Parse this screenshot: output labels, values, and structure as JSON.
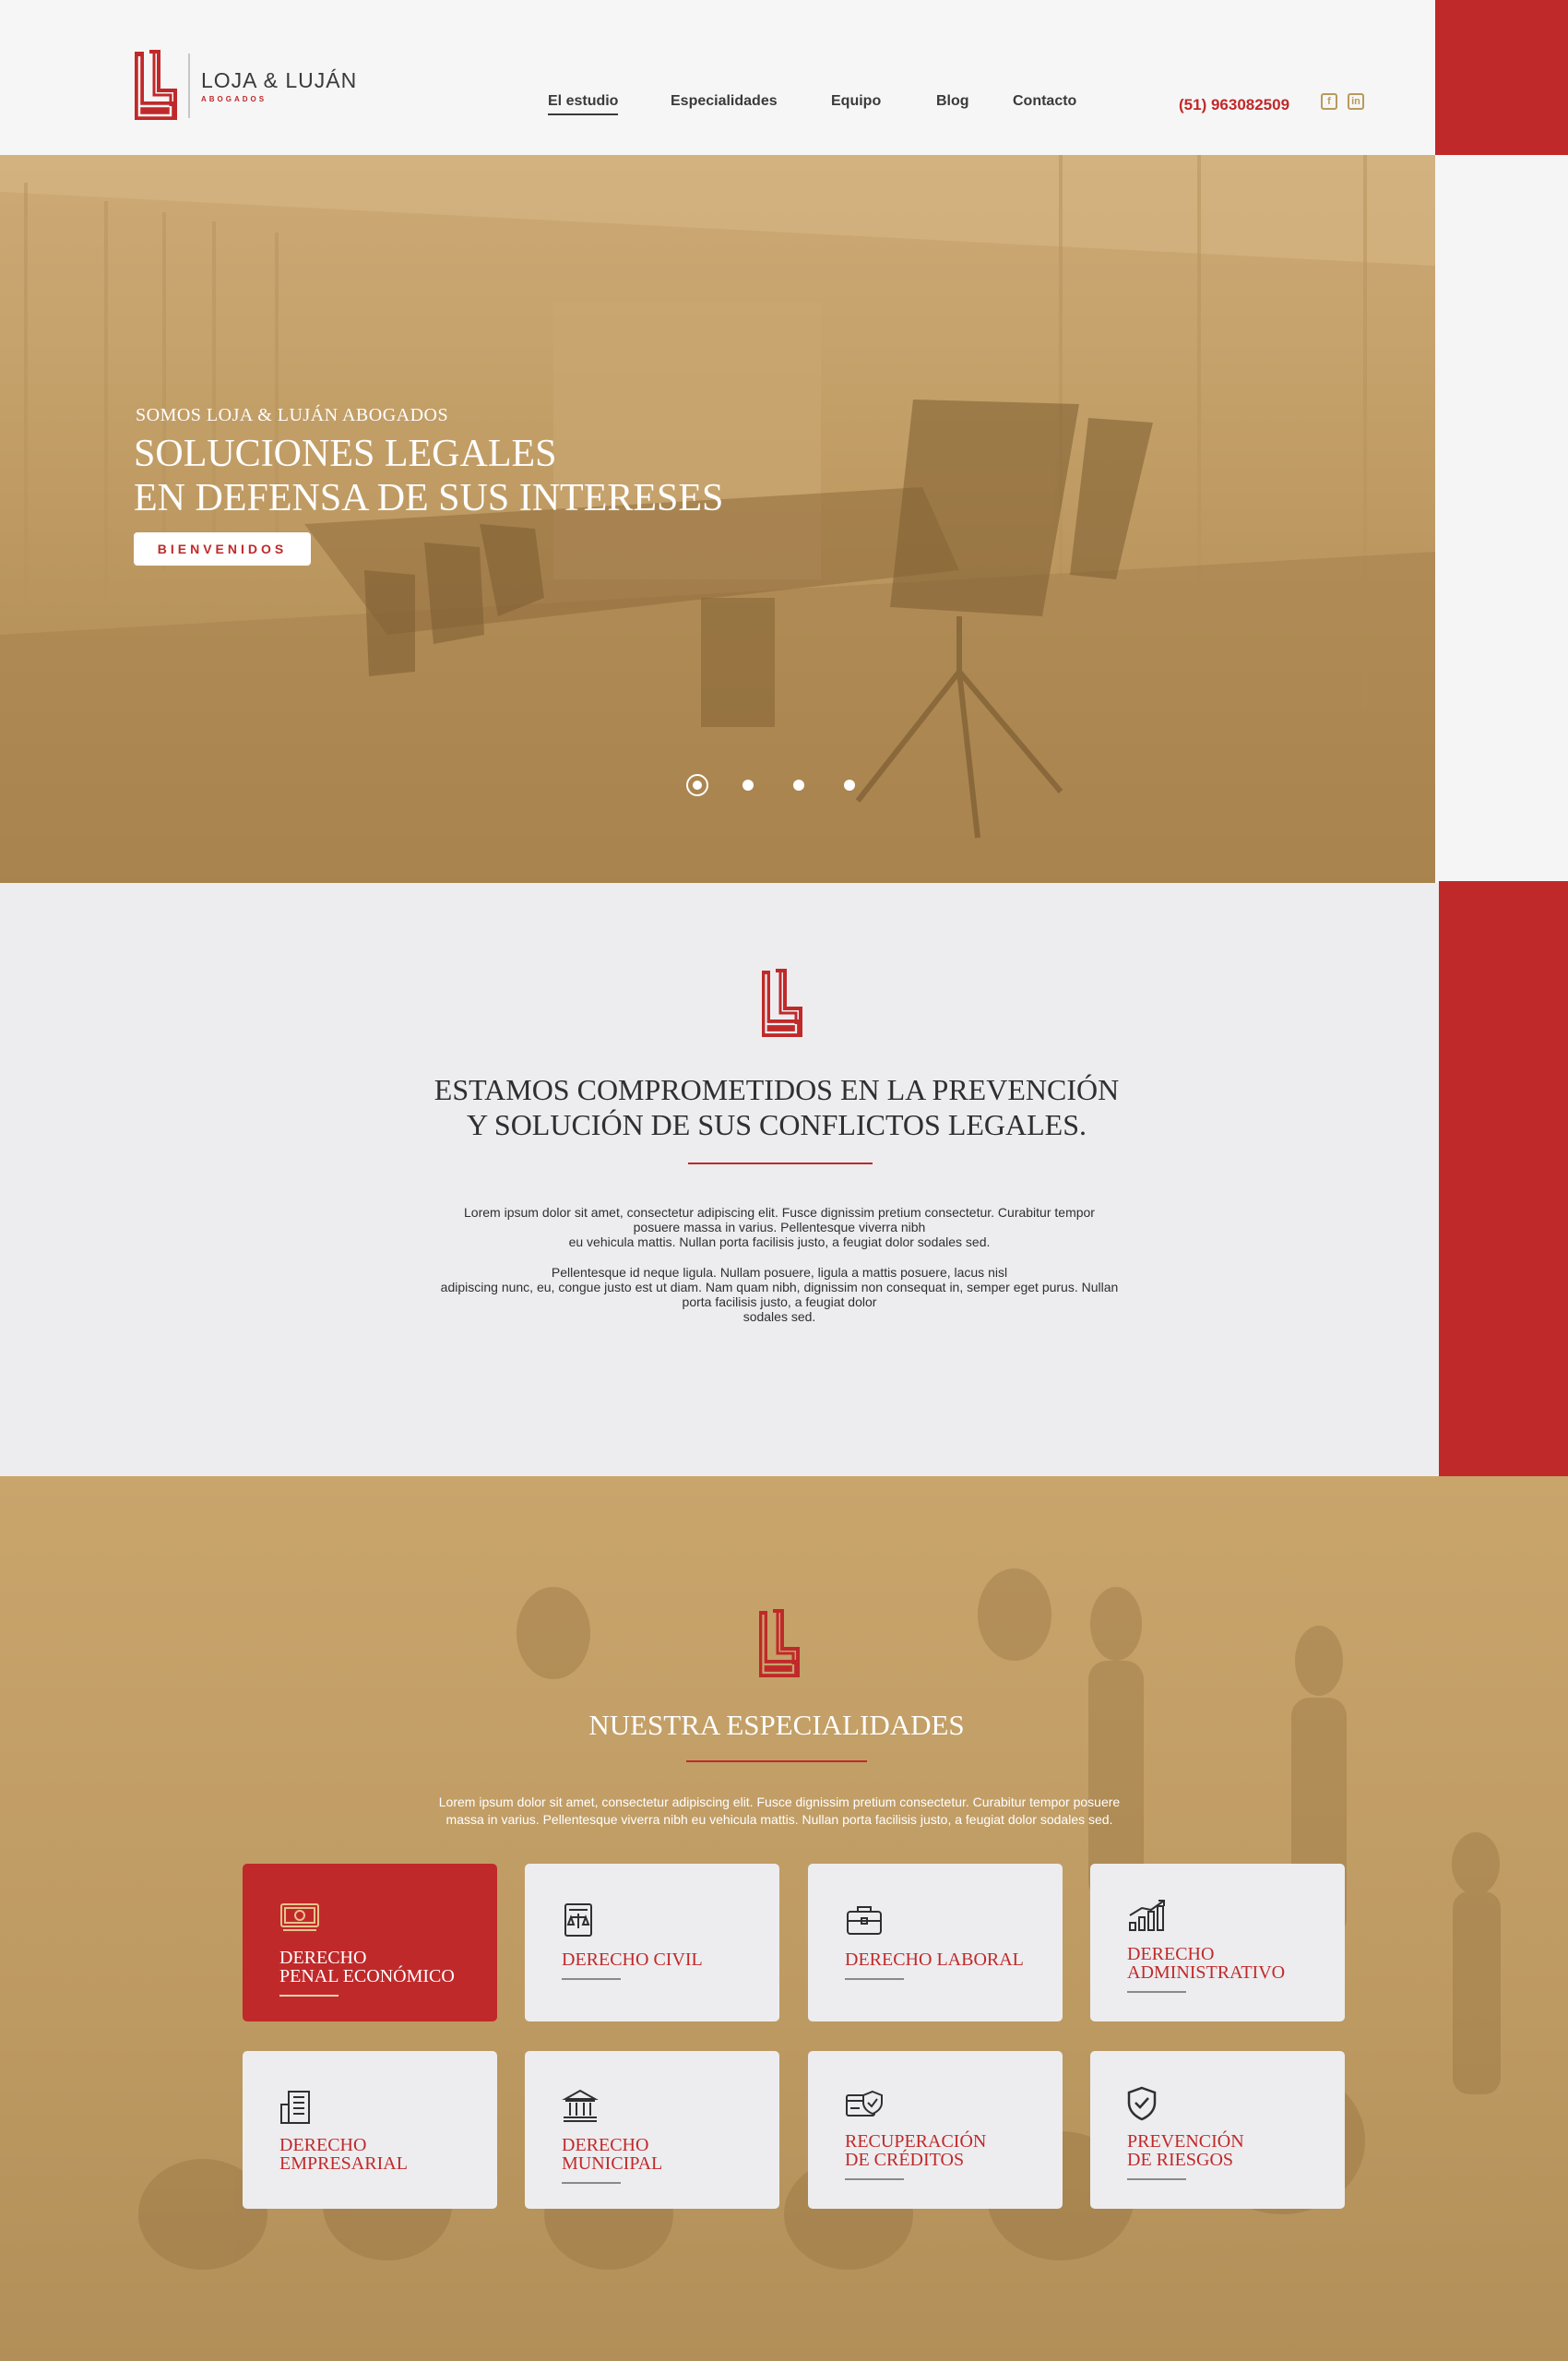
{
  "brand": {
    "name": "LOJA & LUJÁN",
    "subtitle": "ABOGADOS",
    "red": "#c0292a",
    "gold": "#c4a06a"
  },
  "nav": {
    "items": [
      "El estudio",
      "Especialidades",
      "Equipo",
      "Blog",
      "Contacto"
    ],
    "active": "El estudio"
  },
  "header": {
    "phone": "(51) 963082509",
    "social": [
      "facebook-icon",
      "linkedin-icon"
    ],
    "social_glyphs": [
      "f",
      "in"
    ]
  },
  "hero": {
    "kicker": "SOMOS LOJA & LUJÁN ABOGADOS",
    "title_line1": "SOLUCIONES LEGALES",
    "title_line2": "EN DEFENSA DE SUS INTERESES",
    "button": "BIENVENIDOS",
    "slides": 4,
    "active_slide": 1
  },
  "about": {
    "title_line1": "ESTAMOS COMPROMETIDOS EN LA PREVENCIÓN",
    "title_line2": "Y SOLUCIÓN DE SUS CONFLICTOS LEGALES.",
    "para1": [
      "Lorem ipsum dolor sit amet, consectetur adipiscing elit. Fusce dignissim pretium consectetur. Curabitur tempor",
      "posuere massa in varius. Pellentesque viverra nibh",
      "eu vehicula mattis. Nullan porta facilisis justo, a feugiat dolor sodales sed."
    ],
    "para2": [
      "Pellentesque id neque ligula. Nullam posuere, ligula a mattis posuere, lacus nisl",
      "adipiscing nunc, eu, congue justo est ut diam. Nam quam nibh, dignissim non consequat in, semper eget purus. Nullan",
      "porta facilisis justo, a feugiat dolor",
      "sodales sed."
    ]
  },
  "specialties": {
    "title": "NUESTRA ESPECIALIDADES",
    "intro_line1": "Lorem ipsum dolor sit amet, consectetur adipiscing elit. Fusce dignissim pretium consectetur. Curabitur tempor posuere",
    "intro_line2": "massa in varius. Pellentesque viverra nibh eu vehicula mattis. Nullan porta facilisis justo, a feugiat dolor sodales sed.",
    "cards": [
      {
        "line1": "DERECHO",
        "line2": "PENAL ECONÓMICO",
        "icon": "money-icon",
        "active": true
      },
      {
        "line1": "DERECHO CIVIL",
        "line2": "",
        "icon": "document-scale-icon",
        "active": false
      },
      {
        "line1": "DERECHO LABORAL",
        "line2": "",
        "icon": "briefcase-icon",
        "active": false
      },
      {
        "line1": "DERECHO",
        "line2": "ADMINISTRATIVO",
        "icon": "growth-chart-icon",
        "active": false
      },
      {
        "line1": "DERECHO",
        "line2": "EMPRESARIAL",
        "icon": "building-icon",
        "active": false
      },
      {
        "line1": "DERECHO",
        "line2": "MUNICIPAL",
        "icon": "municipal-building-icon",
        "active": false
      },
      {
        "line1": "RECUPERACIÓN",
        "line2": "DE CRÉDITOS",
        "icon": "credit-card-check-icon",
        "active": false
      },
      {
        "line1": "PREVENCIÓN",
        "line2": "DE RIESGOS",
        "icon": "shield-check-icon",
        "active": false
      }
    ]
  }
}
